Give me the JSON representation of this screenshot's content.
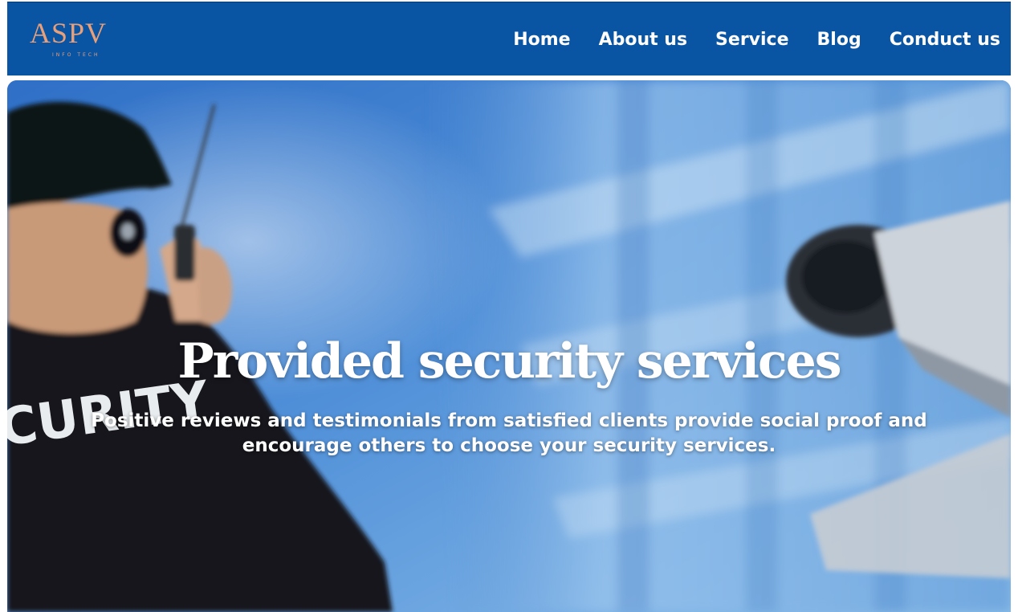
{
  "brand": {
    "logo_text": "ASPV",
    "logo_subtext": "INFO TECH",
    "logo_color": "#e8a07a"
  },
  "nav": {
    "background": "#0a55a3",
    "items": [
      {
        "label": "Home"
      },
      {
        "label": "About us"
      },
      {
        "label": "Service"
      },
      {
        "label": "Blog"
      },
      {
        "label": "Conduct us"
      }
    ]
  },
  "hero": {
    "title": "Provided security services",
    "description": "Positive reviews and testimonials from satisfied clients provide social proof and encourage others to choose your security services.",
    "image_text": "CURITY"
  }
}
